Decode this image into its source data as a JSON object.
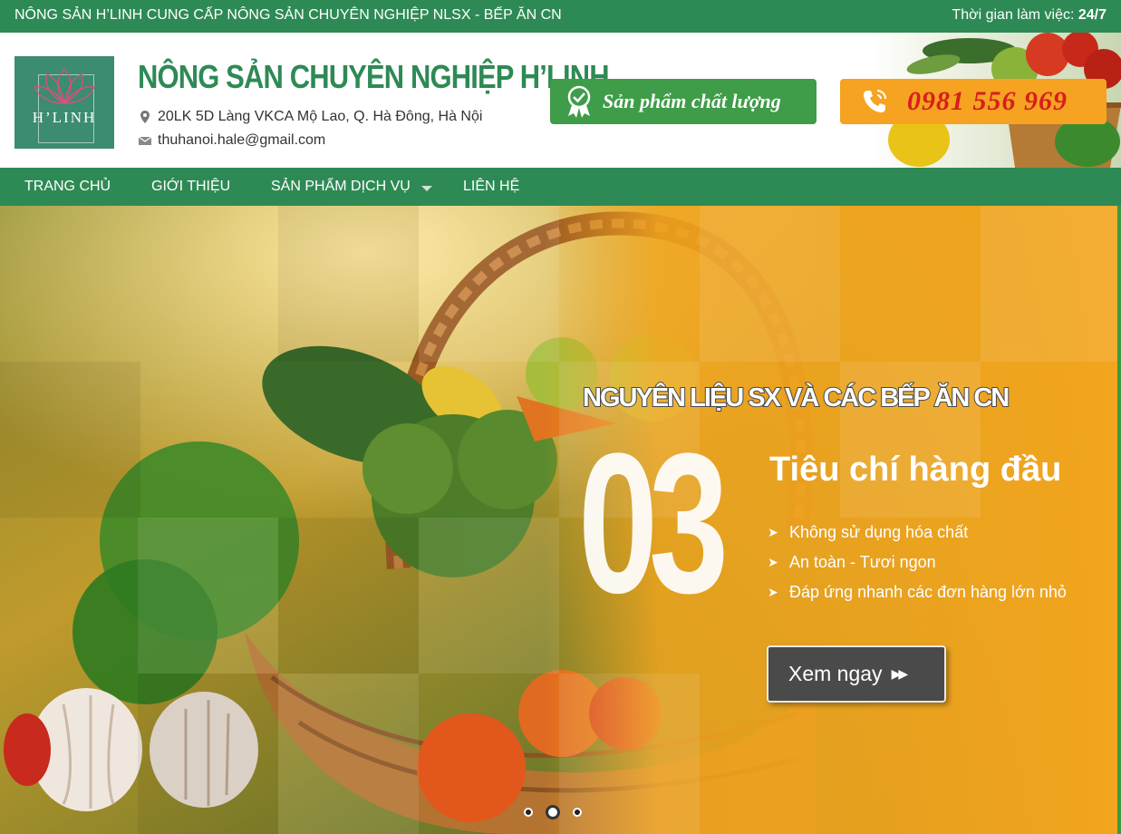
{
  "topbar": {
    "left_text": "NÔNG SẢN H’LINH CUNG CẤP NÔNG SẢN CHUYÊN NGHIỆP NLSX - BẾP ĂN CN",
    "hours_label": "Thời gian làm việc:",
    "hours_value": "24/7"
  },
  "header": {
    "logo_text": "H’LINH",
    "brand": "NÔNG SẢN CHUYÊN NGHIỆP H’LINH",
    "address": "20LK 5D Làng VKCA Mộ Lao, Q. Hà Đông, Hà Nội",
    "email": "thuhanoi.hale@gmail.com",
    "quality_label": "Sản phẩm chất lượng",
    "phone": "0981 556 969",
    "icons": [
      "location-pin-icon",
      "envelope-icon",
      "quality-badge-icon",
      "phone-icon"
    ]
  },
  "nav": {
    "items": [
      {
        "label": "TRANG CHỦ"
      },
      {
        "label": "GIỚI THIỆU"
      },
      {
        "label": "SẢN PHẨM DỊCH VỤ"
      },
      {
        "label": "LIÊN HỆ"
      }
    ]
  },
  "banner": {
    "headline": "NGUYÊN LIỆU SX VÀ CÁC BẾP ĂN CN",
    "big_number": "03",
    "title": "Tiêu chí hàng đầu",
    "bullets": [
      "Không sử dụng hóa chất",
      "An toàn - Tươi ngon",
      "Đáp ứng nhanh các đơn hàng lớn nhỏ"
    ],
    "cta_label": "Xem ngay",
    "slides_total": 3,
    "active_slide": 2
  },
  "colors": {
    "brand_green": "#2e8a55",
    "quality_green": "#3f9c48",
    "phone_orange": "#f5a321",
    "phone_red": "#d81e1e",
    "banner_orange": "#f2a51e"
  }
}
